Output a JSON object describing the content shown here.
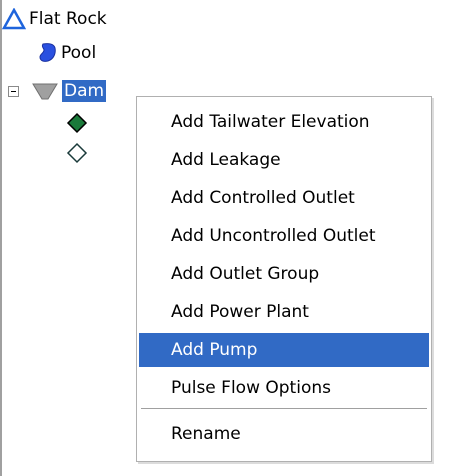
{
  "tree": {
    "nodes": [
      {
        "label": "Flat Rock",
        "icon": "triangle-icon"
      },
      {
        "label": "Pool",
        "icon": "pool-icon"
      },
      {
        "label": "Dam",
        "icon": "dam-icon",
        "expanded": true,
        "selected": true
      },
      {
        "label": "",
        "icon": "filled-diamond-icon"
      },
      {
        "label": "",
        "icon": "hollow-diamond-icon"
      }
    ]
  },
  "context_menu": {
    "items": [
      {
        "label": "Add Tailwater Elevation"
      },
      {
        "label": "Add Leakage"
      },
      {
        "label": "Add Controlled Outlet"
      },
      {
        "label": "Add Uncontrolled Outlet"
      },
      {
        "label": "Add Outlet Group"
      },
      {
        "label": "Add Power Plant"
      },
      {
        "label": "Add Pump",
        "highlighted": true
      },
      {
        "label": "Pulse Flow Options"
      },
      {
        "label": "Rename"
      }
    ]
  },
  "colors": {
    "selection": "#316ac5",
    "triangle_outline": "#1e64dc",
    "triangle_fill": "#ffffff",
    "pool_fill": "#2a50e0",
    "dam_fill": "#a0a0a0",
    "diamond_fill": "#1a7a3a"
  }
}
